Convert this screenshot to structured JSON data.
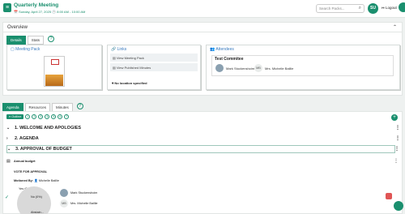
{
  "header": {
    "title": "Quarterly Meeting",
    "subtitle": "📅 Sunday, April 27, 2025 🕒 8:00 AM - 10:00 AM",
    "search_placeholder": "Search Packs...",
    "avatar_initials": "SU",
    "logout_label": "Logout"
  },
  "overview": {
    "title": "Overview",
    "tabs": [
      "Details",
      "Stats"
    ],
    "meeting_pack": {
      "title": "Meeting Pack"
    },
    "links": {
      "title": "Links",
      "items": [
        "View Meeting Pack",
        "View Published Minutes"
      ],
      "location": "No location specified"
    },
    "attendees": {
      "title": "Attendees",
      "committee": "Test Commitee",
      "people": [
        {
          "name": "Mark Stuckenshoim",
          "initials": ""
        },
        {
          "name": "Mrs. Michelle Baillie",
          "initials": "MB"
        }
      ]
    }
  },
  "agenda": {
    "tabs": [
      "Agenda",
      "Resources",
      "Minutes"
    ],
    "outline_label": "Outline",
    "toolbar_icons": [
      "1",
      "2",
      "3",
      "4",
      "5",
      "6",
      "7"
    ],
    "items": [
      "1. WELCOME AND APOLOGIES",
      "2. AGENDA",
      "3. APPROVAL OF BUDGET"
    ],
    "sub_item": "Annual budget",
    "vote_heading": "VOTE FOR APPROVAL",
    "moved_by_label": "Motioned By:",
    "moved_by_name": "Michelle Baillie",
    "vote_yes": "Yes (0%)",
    "vote_no": "No (0%)",
    "vote_abstain": "Abstain...",
    "voters": [
      {
        "name": "Mark Stuckenshoim",
        "initials": ""
      },
      {
        "name": "Mrs. Michelle Baillie",
        "initials": "MB"
      }
    ]
  },
  "colors": {
    "accent": "#1a8f6e",
    "link": "#3a7bbf"
  }
}
